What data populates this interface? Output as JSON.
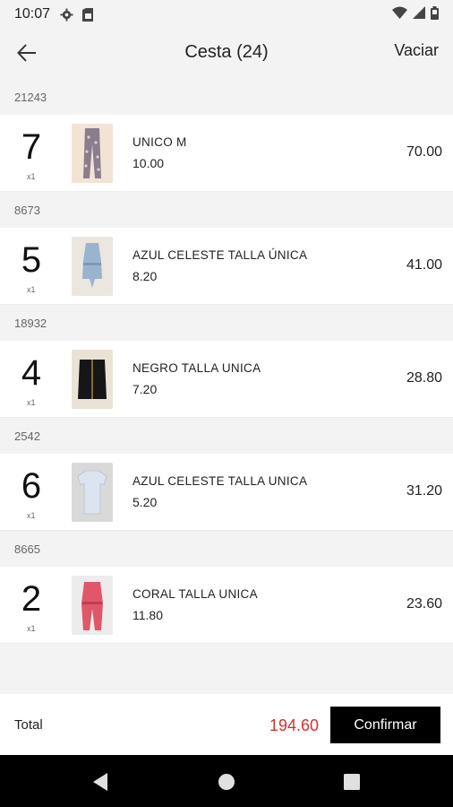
{
  "status_bar": {
    "time": "10:07",
    "icons": [
      "gear-icon",
      "sim-card-icon",
      "wifi-icon",
      "signal-icon",
      "battery-icon"
    ]
  },
  "app_bar": {
    "title": "Cesta (24)",
    "clear_label": "Vaciar",
    "back_icon": "arrow-left-icon"
  },
  "cart": {
    "groups": [
      {
        "reference": "21243",
        "quantity": "7",
        "unit": "x1",
        "variant": "UNICO  M",
        "unit_price": "10.00",
        "line_total": "70.00",
        "garment": "printed pants"
      },
      {
        "reference": "8673",
        "quantity": "5",
        "unit": "x1",
        "variant": "AZUL CELESTE TALLA ÚNICA",
        "unit_price": "8.20",
        "line_total": "41.00",
        "garment": "light blue romper"
      },
      {
        "reference": "18932",
        "quantity": "4",
        "unit": "x1",
        "variant": "NEGRO TALLA UNICA",
        "unit_price": "7.20",
        "line_total": "28.80",
        "garment": "black skirt"
      },
      {
        "reference": "2542",
        "quantity": "6",
        "unit": "x1",
        "variant": "AZUL CELESTE TALLA UNICA",
        "unit_price": "5.20",
        "line_total": "31.20",
        "garment": "light blue t-shirt"
      },
      {
        "reference": "8665",
        "quantity": "2",
        "unit": "x1",
        "variant": "CORAL TALLA UNICA",
        "unit_price": "11.80",
        "line_total": "23.60",
        "garment": "coral jumpsuit"
      }
    ]
  },
  "footer": {
    "total_label": "Total",
    "total_value": "194.60",
    "confirm_label": "Confirmar"
  },
  "colors": {
    "accent_total": "#d32f2f",
    "button_bg": "#000000",
    "background": "#f3f3f3"
  },
  "nav_bar": {
    "icons": [
      "back-triangle-icon",
      "home-circle-icon",
      "recents-square-icon"
    ]
  }
}
